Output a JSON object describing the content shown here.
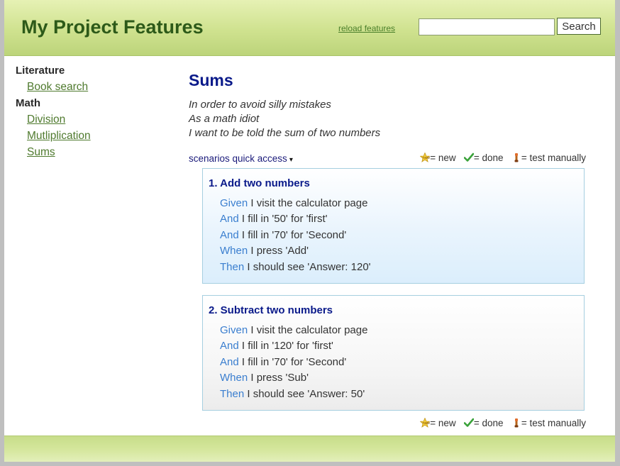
{
  "header": {
    "title": "My Project Features",
    "reload_label": "reload features",
    "search_placeholder": "",
    "search_button": "Search"
  },
  "sidebar": {
    "categories": [
      {
        "name": "Literature",
        "items": [
          "Book search"
        ]
      },
      {
        "name": "Math",
        "items": [
          "Division",
          "Mutliplication",
          "Sums"
        ]
      }
    ]
  },
  "feature": {
    "title": "Sums",
    "narrative": [
      "In order to avoid silly mistakes",
      "As a math idiot",
      "I want to be told the sum of two numbers"
    ]
  },
  "quick_access": {
    "label": "scenarios quick access",
    "caret": "▾"
  },
  "legend": {
    "new": "= new",
    "done": "= done",
    "manual": "= test manually"
  },
  "scenarios": [
    {
      "title": "1. Add two numbers",
      "steps": [
        {
          "keyword": "Given",
          "text": " I visit the calculator page"
        },
        {
          "keyword": "And",
          "text": " I fill in '50' for 'first'"
        },
        {
          "keyword": "And",
          "text": " I fill in '70' for 'Second'"
        },
        {
          "keyword": "When",
          "text": " I press 'Add'"
        },
        {
          "keyword": "Then",
          "text": " I should see 'Answer: 120'"
        }
      ]
    },
    {
      "title": "2. Subtract two numbers",
      "steps": [
        {
          "keyword": "Given",
          "text": " I visit the calculator page"
        },
        {
          "keyword": "And",
          "text": " I fill in '120' for 'first'"
        },
        {
          "keyword": "And",
          "text": " I fill in '70' for 'Second'"
        },
        {
          "keyword": "When",
          "text": " I press 'Sub'"
        },
        {
          "keyword": "Then",
          "text": " I should see 'Answer: 50'"
        }
      ]
    }
  ],
  "colors": {
    "header_green": "#cfe28f",
    "title_green": "#2d5a19",
    "heading_blue": "#0a1a8a",
    "keyword_blue": "#3a7ecf"
  }
}
